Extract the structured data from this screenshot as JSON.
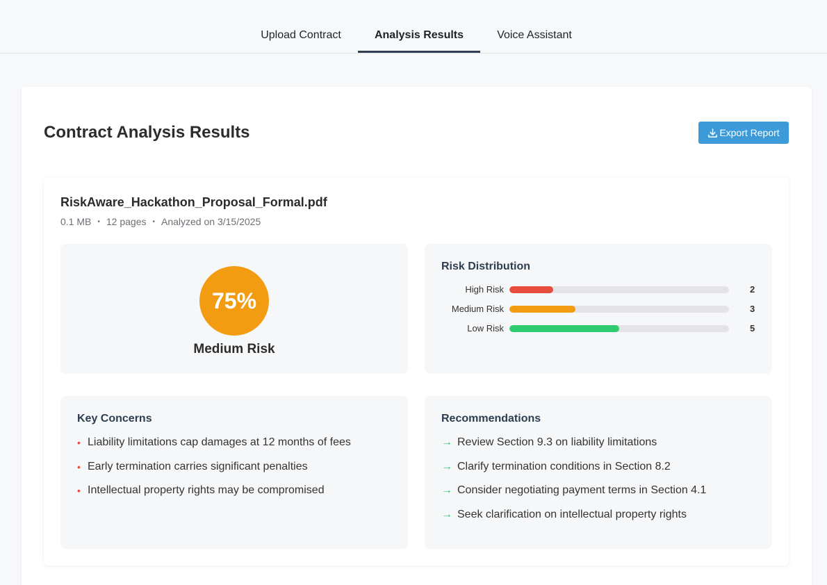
{
  "tabs": [
    {
      "label": "Upload Contract",
      "active": false
    },
    {
      "label": "Analysis Results",
      "active": true
    },
    {
      "label": "Voice Assistant",
      "active": false
    }
  ],
  "page": {
    "title": "Contract Analysis Results",
    "export_label": "Export Report"
  },
  "document": {
    "filename": "RiskAware_Hackathon_Proposal_Formal.pdf",
    "size": "0.1 MB",
    "pages": "12 pages",
    "analyzed": "Analyzed on 3/15/2025"
  },
  "score": {
    "value": "75%",
    "label": "Medium Risk",
    "color": "#f39c12"
  },
  "distribution": {
    "title": "Risk Distribution",
    "rows": [
      {
        "label": "High Risk",
        "count": "2",
        "fraction": 0.2,
        "color": "#e74c3c"
      },
      {
        "label": "Medium Risk",
        "count": "3",
        "fraction": 0.3,
        "color": "#f39c12"
      },
      {
        "label": "Low Risk",
        "count": "5",
        "fraction": 0.5,
        "color": "#2ecc71"
      }
    ]
  },
  "concerns": {
    "title": "Key Concerns",
    "items": [
      "Liability limitations cap damages at 12 months of fees",
      "Early termination carries significant penalties",
      "Intellectual property rights may be compromised"
    ]
  },
  "recommendations": {
    "title": "Recommendations",
    "items": [
      "Review Section 9.3 on liability limitations",
      "Clarify termination conditions in Section 8.2",
      "Consider negotiating payment terms in Section 4.1",
      "Seek clarification on intellectual property rights"
    ]
  },
  "icons": {
    "export": "download-icon",
    "concern_bullet": "bullet-icon",
    "recommendation_bullet": "arrow-right-icon"
  }
}
